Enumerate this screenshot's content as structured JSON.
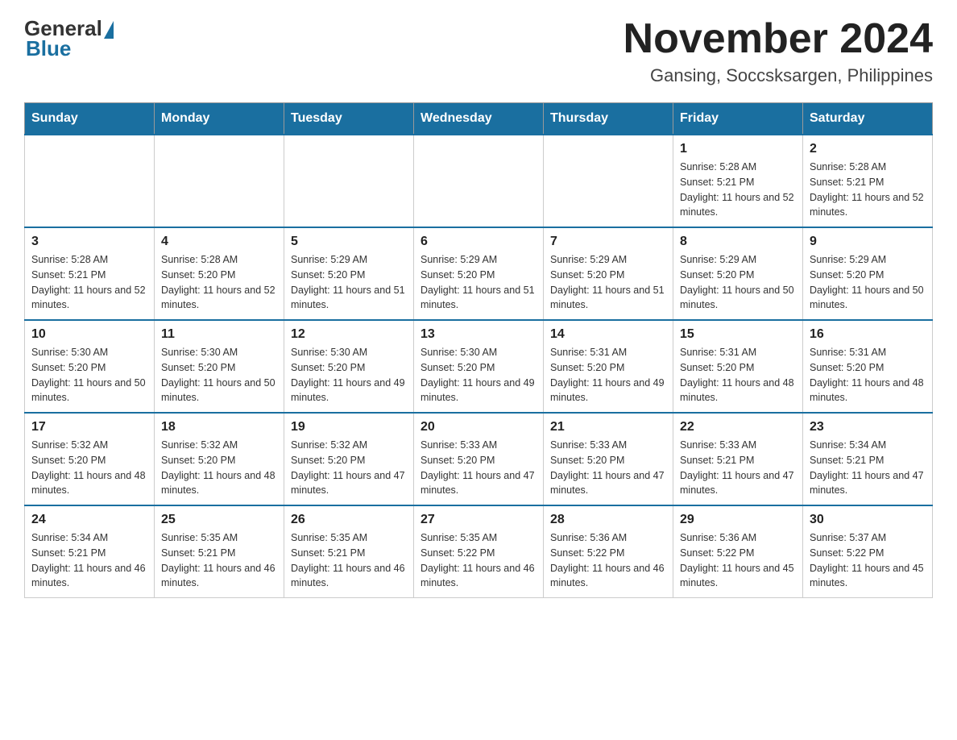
{
  "logo": {
    "general": "General",
    "blue": "Blue"
  },
  "title": {
    "month_year": "November 2024",
    "location": "Gansing, Soccsksargen, Philippines"
  },
  "weekdays": [
    "Sunday",
    "Monday",
    "Tuesday",
    "Wednesday",
    "Thursday",
    "Friday",
    "Saturday"
  ],
  "weeks": [
    [
      {
        "day": "",
        "info": ""
      },
      {
        "day": "",
        "info": ""
      },
      {
        "day": "",
        "info": ""
      },
      {
        "day": "",
        "info": ""
      },
      {
        "day": "",
        "info": ""
      },
      {
        "day": "1",
        "info": "Sunrise: 5:28 AM\nSunset: 5:21 PM\nDaylight: 11 hours and 52 minutes."
      },
      {
        "day": "2",
        "info": "Sunrise: 5:28 AM\nSunset: 5:21 PM\nDaylight: 11 hours and 52 minutes."
      }
    ],
    [
      {
        "day": "3",
        "info": "Sunrise: 5:28 AM\nSunset: 5:21 PM\nDaylight: 11 hours and 52 minutes."
      },
      {
        "day": "4",
        "info": "Sunrise: 5:28 AM\nSunset: 5:20 PM\nDaylight: 11 hours and 52 minutes."
      },
      {
        "day": "5",
        "info": "Sunrise: 5:29 AM\nSunset: 5:20 PM\nDaylight: 11 hours and 51 minutes."
      },
      {
        "day": "6",
        "info": "Sunrise: 5:29 AM\nSunset: 5:20 PM\nDaylight: 11 hours and 51 minutes."
      },
      {
        "day": "7",
        "info": "Sunrise: 5:29 AM\nSunset: 5:20 PM\nDaylight: 11 hours and 51 minutes."
      },
      {
        "day": "8",
        "info": "Sunrise: 5:29 AM\nSunset: 5:20 PM\nDaylight: 11 hours and 50 minutes."
      },
      {
        "day": "9",
        "info": "Sunrise: 5:29 AM\nSunset: 5:20 PM\nDaylight: 11 hours and 50 minutes."
      }
    ],
    [
      {
        "day": "10",
        "info": "Sunrise: 5:30 AM\nSunset: 5:20 PM\nDaylight: 11 hours and 50 minutes."
      },
      {
        "day": "11",
        "info": "Sunrise: 5:30 AM\nSunset: 5:20 PM\nDaylight: 11 hours and 50 minutes."
      },
      {
        "day": "12",
        "info": "Sunrise: 5:30 AM\nSunset: 5:20 PM\nDaylight: 11 hours and 49 minutes."
      },
      {
        "day": "13",
        "info": "Sunrise: 5:30 AM\nSunset: 5:20 PM\nDaylight: 11 hours and 49 minutes."
      },
      {
        "day": "14",
        "info": "Sunrise: 5:31 AM\nSunset: 5:20 PM\nDaylight: 11 hours and 49 minutes."
      },
      {
        "day": "15",
        "info": "Sunrise: 5:31 AM\nSunset: 5:20 PM\nDaylight: 11 hours and 48 minutes."
      },
      {
        "day": "16",
        "info": "Sunrise: 5:31 AM\nSunset: 5:20 PM\nDaylight: 11 hours and 48 minutes."
      }
    ],
    [
      {
        "day": "17",
        "info": "Sunrise: 5:32 AM\nSunset: 5:20 PM\nDaylight: 11 hours and 48 minutes."
      },
      {
        "day": "18",
        "info": "Sunrise: 5:32 AM\nSunset: 5:20 PM\nDaylight: 11 hours and 48 minutes."
      },
      {
        "day": "19",
        "info": "Sunrise: 5:32 AM\nSunset: 5:20 PM\nDaylight: 11 hours and 47 minutes."
      },
      {
        "day": "20",
        "info": "Sunrise: 5:33 AM\nSunset: 5:20 PM\nDaylight: 11 hours and 47 minutes."
      },
      {
        "day": "21",
        "info": "Sunrise: 5:33 AM\nSunset: 5:20 PM\nDaylight: 11 hours and 47 minutes."
      },
      {
        "day": "22",
        "info": "Sunrise: 5:33 AM\nSunset: 5:21 PM\nDaylight: 11 hours and 47 minutes."
      },
      {
        "day": "23",
        "info": "Sunrise: 5:34 AM\nSunset: 5:21 PM\nDaylight: 11 hours and 47 minutes."
      }
    ],
    [
      {
        "day": "24",
        "info": "Sunrise: 5:34 AM\nSunset: 5:21 PM\nDaylight: 11 hours and 46 minutes."
      },
      {
        "day": "25",
        "info": "Sunrise: 5:35 AM\nSunset: 5:21 PM\nDaylight: 11 hours and 46 minutes."
      },
      {
        "day": "26",
        "info": "Sunrise: 5:35 AM\nSunset: 5:21 PM\nDaylight: 11 hours and 46 minutes."
      },
      {
        "day": "27",
        "info": "Sunrise: 5:35 AM\nSunset: 5:22 PM\nDaylight: 11 hours and 46 minutes."
      },
      {
        "day": "28",
        "info": "Sunrise: 5:36 AM\nSunset: 5:22 PM\nDaylight: 11 hours and 46 minutes."
      },
      {
        "day": "29",
        "info": "Sunrise: 5:36 AM\nSunset: 5:22 PM\nDaylight: 11 hours and 45 minutes."
      },
      {
        "day": "30",
        "info": "Sunrise: 5:37 AM\nSunset: 5:22 PM\nDaylight: 11 hours and 45 minutes."
      }
    ]
  ]
}
